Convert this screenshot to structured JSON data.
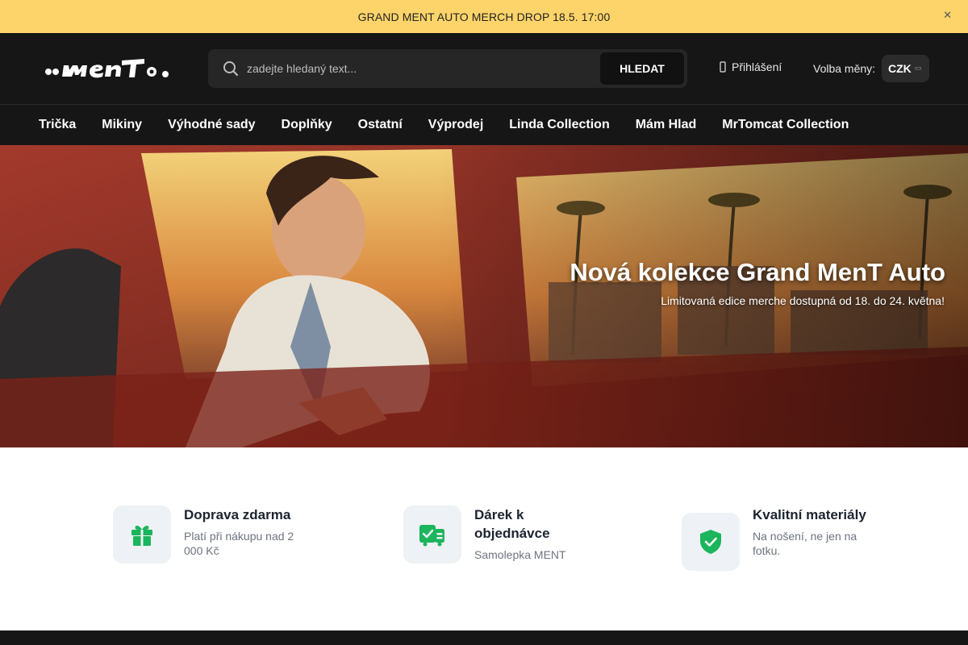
{
  "announcement": {
    "text": "GRAND MENT AUTO MERCH DROP 18.5. 17:00",
    "close_icon": "close-icon"
  },
  "header": {
    "logo_text": "..menT.",
    "search": {
      "placeholder": "zadejte hledaný text...",
      "button_label": "HLEDAT",
      "icon": "search-icon"
    },
    "login_label": "Přihlášení",
    "currency_label": "Volba měny:",
    "currency_value": "CZK"
  },
  "nav": {
    "items": [
      {
        "label": "Trička"
      },
      {
        "label": "Mikiny"
      },
      {
        "label": "Výhodné sady"
      },
      {
        "label": "Doplňky"
      },
      {
        "label": "Ostatní"
      },
      {
        "label": "Výprodej"
      },
      {
        "label": "Linda Collection"
      },
      {
        "label": "Mám Hlad"
      },
      {
        "label": "MrTomcat Collection"
      }
    ]
  },
  "hero": {
    "title": "Nová kolekce Grand MenT Auto",
    "subtitle": "Limitovaná edice merche dostupná od 18. do 24. května!"
  },
  "features": [
    {
      "icon": "gift-icon",
      "title": "Doprava zdarma",
      "desc": "Platí při nákupu nad 2 000 Kč"
    },
    {
      "icon": "gift-card-icon",
      "title": "Dárek k objednávce",
      "desc": "Samolepka MENT"
    },
    {
      "icon": "shield-check-icon",
      "title": "Kvalitní materiály",
      "desc": "Na nošení, ne jen na fotku."
    }
  ],
  "colors": {
    "accent_green": "#1bb55c",
    "announcement_bg": "#fcd46a",
    "header_bg": "#161616"
  }
}
